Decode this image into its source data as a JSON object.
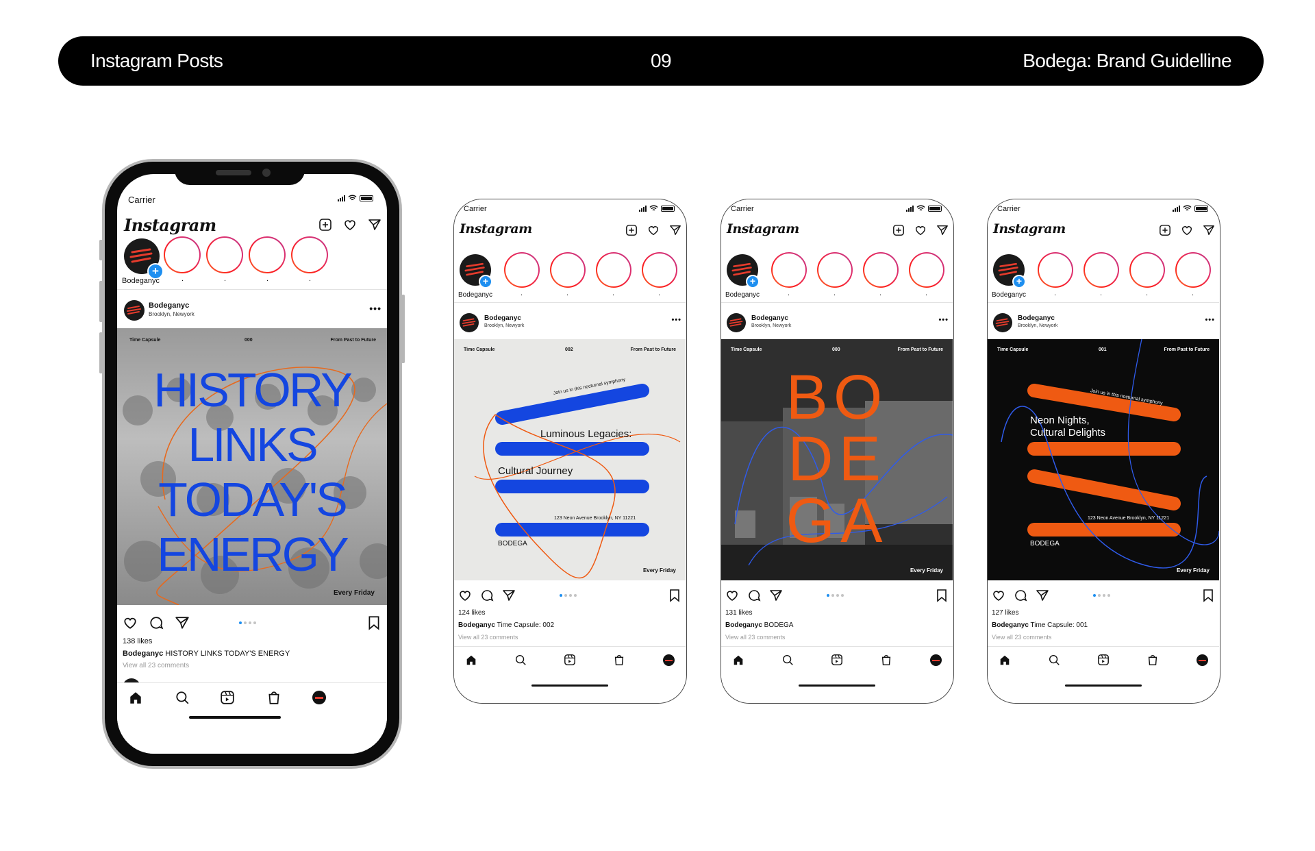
{
  "header": {
    "left": "Instagram Posts",
    "center": "09",
    "right": "Bodega: Brand Guidelline"
  },
  "common": {
    "carrier": "Carrier",
    "ig_logo": "Instagram",
    "own_story_label": "Bodeganyc",
    "story_dot": ".",
    "post_user": "Bodeganyc",
    "post_location": "Brooklyn, Newyork",
    "comments": "View all 23 comments",
    "more": "•••",
    "time_capsule": "Time Capsule",
    "past_future": "From Past to Future",
    "every_friday": "Every Friday",
    "join_text": "Join us in this nocturnal symphony",
    "address": "123 Neon Avenue Brooklyn, NY 11221",
    "bodega": "BODEGA"
  },
  "colors": {
    "blue": "#1446e0",
    "orange": "#ef5a12",
    "black": "#0b0b0b"
  },
  "phones": [
    {
      "id": "phone-1",
      "number": "000",
      "headline": [
        "HISTORY",
        "LINKS",
        "TODAY'S",
        "ENERGY"
      ],
      "likes": "138 likes",
      "caption_user": "Bodeganyc",
      "caption_text": " HISTORY LINKS TODAY'S ENERGY"
    },
    {
      "id": "phone-2",
      "number": "002",
      "line1": "Luminous Legacies:",
      "line2": "Cultural Journey",
      "likes": "124 likes",
      "caption_user": "Bodeganyc",
      "caption_text": " Time Capsule: 002"
    },
    {
      "id": "phone-3",
      "number": "000",
      "letters": [
        "BO",
        "DE",
        "GA"
      ],
      "likes": "131 likes",
      "caption_user": "Bodeganyc",
      "caption_text": " BODEGA"
    },
    {
      "id": "phone-4",
      "number": "001",
      "line1": "Neon Nights,",
      "line2": "Cultural Delights",
      "likes": "127 likes",
      "caption_user": "Bodeganyc",
      "caption_text": " Time Capsule: 001"
    }
  ]
}
